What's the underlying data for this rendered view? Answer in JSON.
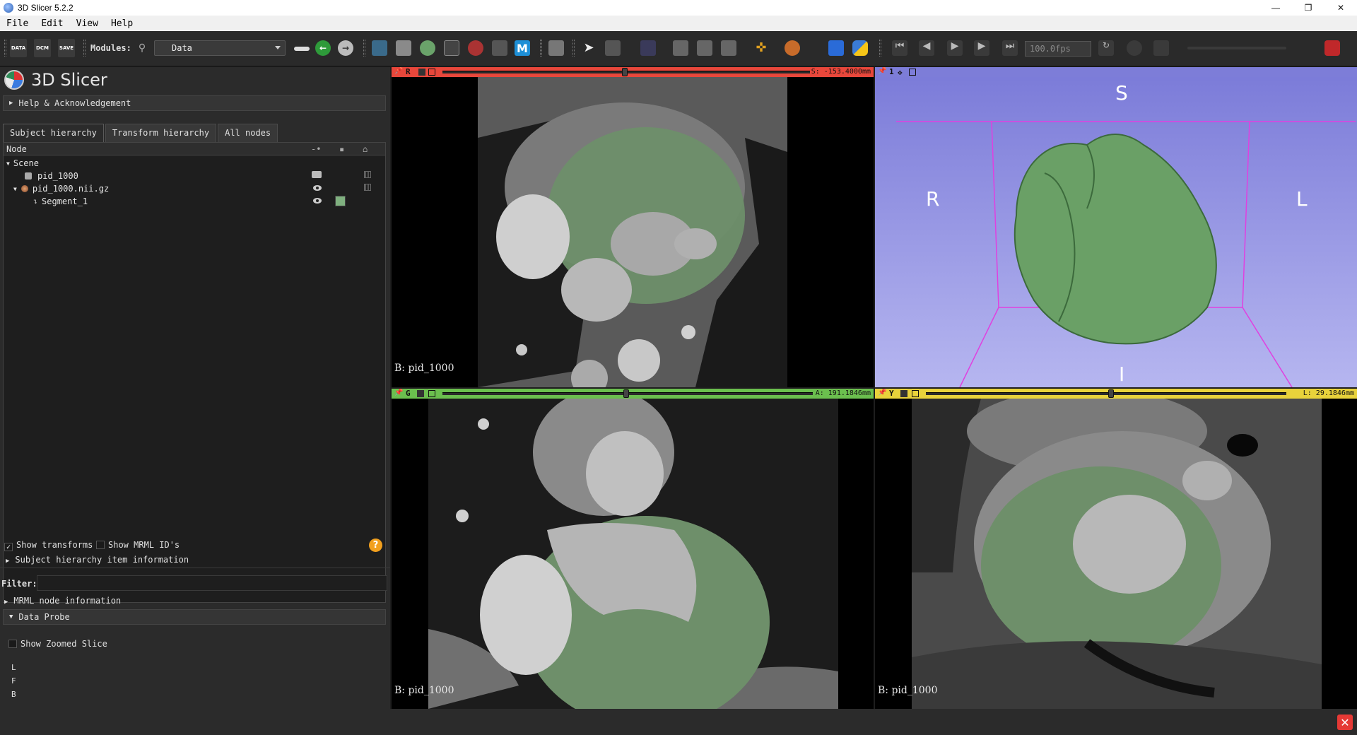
{
  "window": {
    "title": "3D Slicer 5.2.2",
    "minimize": "—",
    "maximize": "❐",
    "close": "✕"
  },
  "menu": [
    "File",
    "Edit",
    "View",
    "Help"
  ],
  "toolbar": {
    "modules_label": "Modules:",
    "module_selected": "Data",
    "fps": "100.0fps",
    "icons": [
      "data-icon",
      "dcm-icon",
      "save-icon",
      "search-icon",
      "back-icon",
      "forward-icon",
      "extensions-icon",
      "box-icon",
      "segment-icon",
      "markups-icon",
      "transform-icon",
      "models-icon",
      "m-icon",
      "screenshot-icon",
      "pointer-icon",
      "layout-icon",
      "python-icon",
      "play-icon"
    ],
    "data_label": "DATA",
    "dcm_label": "DCM",
    "save_label": "SAVE",
    "m_label": "M"
  },
  "left": {
    "app_title": "3D Slicer",
    "help_section": "Help & Acknowledgement",
    "tabs": [
      "Subject hierarchy",
      "Transform hierarchy",
      "All nodes"
    ],
    "tree_header": "Node",
    "tree": {
      "scene": "Scene",
      "items": [
        {
          "label": "pid_1000",
          "level": 1
        },
        {
          "label": "pid_1000.nii.gz",
          "level": 1
        },
        {
          "label": "Segment_1",
          "level": 2
        }
      ]
    },
    "show_transforms": "Show transforms",
    "show_mrml_ids": "Show MRML ID's",
    "item_info": "Subject hierarchy item information",
    "filter_label": "Filter:",
    "mrml_info": "MRML node information",
    "data_probe": "Data Probe",
    "show_zoomed": "Show Zoomed Slice",
    "probe_lines": [
      "L",
      "F",
      "B"
    ],
    "segment_color": "#7fb07f"
  },
  "views": {
    "red": {
      "letter": "R",
      "offset": "S: -153.4000mm",
      "label": "B: pid_1000",
      "color": "#e8473b"
    },
    "threeD": {
      "letter": "1",
      "S": "S",
      "R": "R",
      "L": "L",
      "I": "I",
      "color": "#7d7dd8"
    },
    "green": {
      "letter": "G",
      "offset": "A: 191.1846mm",
      "label": "B: pid_1000",
      "color": "#6bbf4e"
    },
    "yellow": {
      "letter": "Y",
      "offset": "L: 29.1846mm",
      "label": "B: pid_1000",
      "color": "#e8d23b"
    }
  },
  "help_badge": "?",
  "error_badge": "✕"
}
